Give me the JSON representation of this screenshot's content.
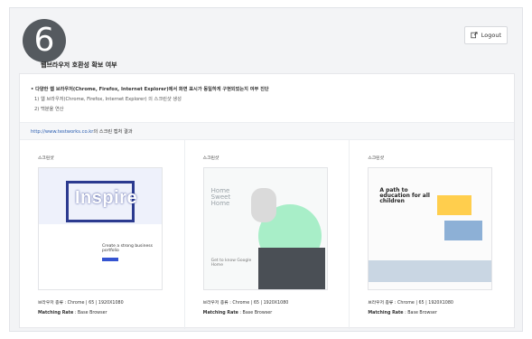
{
  "step_number": "6",
  "header": {
    "logout_label": "Logout"
  },
  "page_title": "웹브라우저 호환성 확보 여부",
  "description": {
    "main": "• 다양한 웹 브라우저(Chrome, Firefox, Internet Explorer)에서 화면 표시가 동일하게 구현되었는지 여부 진단",
    "step1": "1) 웹 브라우저(Chrome, Firefox, Internet Explorer) 의 스크린샷 생성",
    "step2": "2) 백분율 연산"
  },
  "screenshot_result": {
    "url": "http://www.testworks.co.kr",
    "suffix": "의 스크린 캡처 결과"
  },
  "columns": [
    {
      "label": "스크린샷",
      "browser_line": "브라우저 종류 : Chrome | 65 | 1920X1080",
      "matching_label": "Matching Rate",
      "matching_value": " : Base Browser",
      "preview_text": "Inspire",
      "preview_sub": "Create a strong business portfolio"
    },
    {
      "label": "스크린샷",
      "browser_line": "브라우저 종류 : Chrome | 65 | 1920X1080",
      "matching_label": "Matching Rate",
      "matching_value": " : Base Browser",
      "preview_text": "Home Sweet Home",
      "preview_sub": "Get to know Google Home"
    },
    {
      "label": "스크린샷",
      "browser_line": "브라우저 종류 : Chrome | 65 | 1920X1080",
      "matching_label": "Matching Rate",
      "matching_value": " : Base Browser",
      "preview_text": "A path to education for all children",
      "preview_sub": ""
    }
  ]
}
